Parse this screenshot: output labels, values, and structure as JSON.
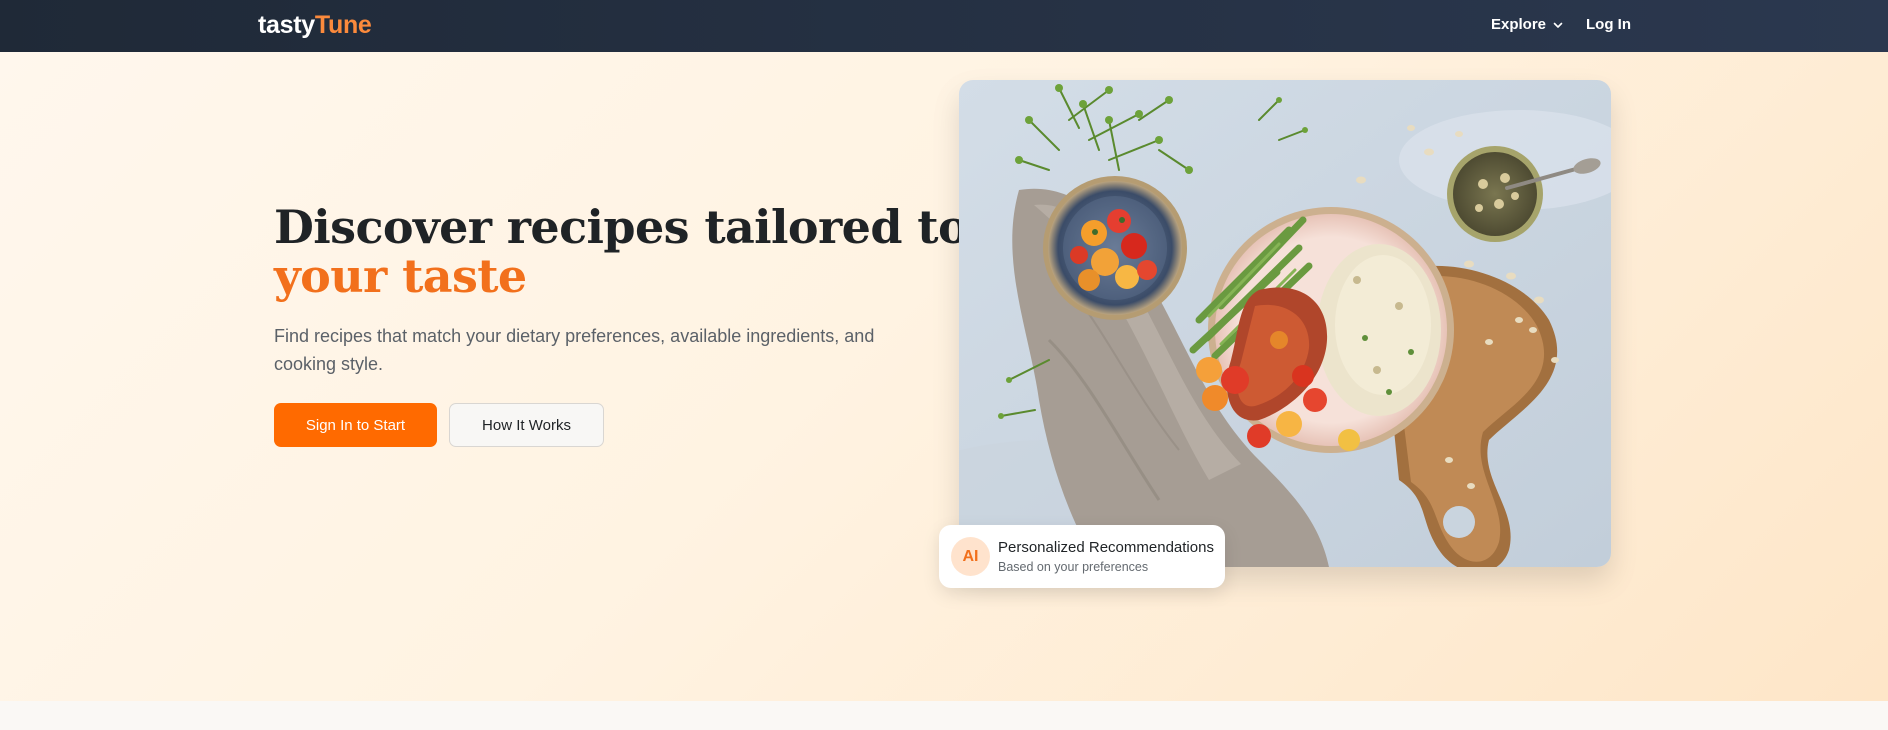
{
  "brand": {
    "name_part1": "tasty",
    "name_part2": "Tune"
  },
  "nav": {
    "explore_label": "Explore",
    "login_label": "Log In"
  },
  "hero": {
    "title_line1": "Discover recipes tailored to",
    "title_accent": "your taste",
    "subtitle": "Find recipes that match your dietary preferences, available ingredients, and cooking style.",
    "primary_button": "Sign In to Start",
    "secondary_button": "How It Works"
  },
  "recommendation_card": {
    "badge": "AI",
    "title": "Personalized Recommendations",
    "subtitle": "Based on your preferences"
  },
  "colors": {
    "accent": "#ff6a00",
    "nav_bg": "#1f2937",
    "brand_accent": "#fb8a3c"
  },
  "icons": {
    "explore_dropdown": "chevron-down-icon"
  }
}
